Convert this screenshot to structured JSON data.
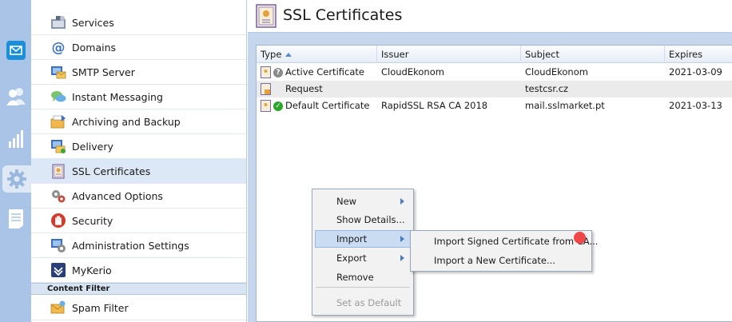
{
  "rail": {
    "items": [
      {
        "name": "mail-icon"
      },
      {
        "name": "users-icon"
      },
      {
        "name": "statistics-icon"
      },
      {
        "name": "configuration-icon"
      },
      {
        "name": "logs-icon"
      }
    ],
    "active_index": 3,
    "accent": "#1b8fd8"
  },
  "sidebar": {
    "items": [
      {
        "label": "Services",
        "icon": "services-icon"
      },
      {
        "label": "Domains",
        "icon": "at-sign-icon"
      },
      {
        "label": "SMTP Server",
        "icon": "smtp-server-icon"
      },
      {
        "label": "Instant Messaging",
        "icon": "chat-bubbles-icon"
      },
      {
        "label": "Archiving and Backup",
        "icon": "archive-icon"
      },
      {
        "label": "Delivery",
        "icon": "delivery-icon"
      },
      {
        "label": "SSL Certificates",
        "icon": "certificate-icon"
      },
      {
        "label": "Advanced Options",
        "icon": "gears-icon"
      },
      {
        "label": "Security",
        "icon": "security-hand-icon"
      },
      {
        "label": "Administration Settings",
        "icon": "admin-settings-icon"
      },
      {
        "label": "MyKerio",
        "icon": "mykerio-icon"
      }
    ],
    "selected_index": 6,
    "section_header": "Content Filter",
    "section_items": [
      {
        "label": "Spam Filter",
        "icon": "spam-filter-icon"
      }
    ]
  },
  "main": {
    "title": "SSL Certificates",
    "title_icon": "certificate-icon"
  },
  "table": {
    "columns": [
      "Type",
      "Issuer",
      "Subject",
      "Expires"
    ],
    "sort_column": "Type",
    "rows": [
      {
        "status": "unknown",
        "type": "Active Certificate",
        "issuer": "CloudEkonom",
        "subject": "CloudEkonom",
        "expires": "2021-03-09"
      },
      {
        "status": "request",
        "type": "Request",
        "issuer": "",
        "subject": "testcsr.cz",
        "expires": ""
      },
      {
        "status": "ok",
        "type": "Default Certificate",
        "issuer": "RapidSSL RSA CA 2018",
        "subject": "mail.sslmarket.pt",
        "expires": "2021-03-13"
      }
    ],
    "selected_row": 1
  },
  "context_menu": {
    "items": [
      {
        "label": "New",
        "submenu": true,
        "disabled": false
      },
      {
        "label": "Show Details...",
        "submenu": false,
        "disabled": false
      },
      {
        "label": "Import",
        "submenu": true,
        "disabled": false
      },
      {
        "label": "Export",
        "submenu": true,
        "disabled": false
      },
      {
        "label": "Remove",
        "submenu": false,
        "disabled": false
      },
      {
        "label": "Set as Default",
        "submenu": false,
        "disabled": true
      }
    ],
    "hover_index": 2
  },
  "import_submenu": {
    "items": [
      {
        "label": "Import Signed Certificate from CA..."
      },
      {
        "label": "Import a New Certificate..."
      }
    ]
  }
}
